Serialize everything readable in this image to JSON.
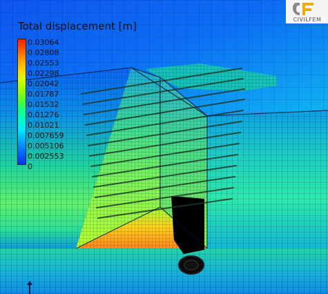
{
  "legend": {
    "title": "Total displacement [m]",
    "values": [
      "0.03064",
      "0.02808",
      "0.02553",
      "0.02298",
      "0.02042",
      "0.01787",
      "0.01532",
      "0.01276",
      "0.01021",
      "0.007659",
      "0.005106",
      "0.002553",
      "0"
    ],
    "colors": [
      "#ff1a00",
      "#ff5a00",
      "#ff9a00",
      "#ffd000",
      "#d8ff00",
      "#9cff00",
      "#5cff2a",
      "#19ff7a",
      "#00ffc0",
      "#00e8ff",
      "#00b4ff",
      "#0078ff",
      "#0033ff"
    ]
  },
  "logo": {
    "text": "CIVILFEM",
    "colors": [
      "#f2a900",
      "#8a8a8a"
    ]
  },
  "scene": {
    "icon": "fem-displacement-mesh",
    "colors": {
      "background": "#0b5bd8",
      "mesh": "#0a1f4d",
      "cavity": "#000000"
    }
  },
  "axis": {
    "icon": "up-arrow-icon"
  }
}
